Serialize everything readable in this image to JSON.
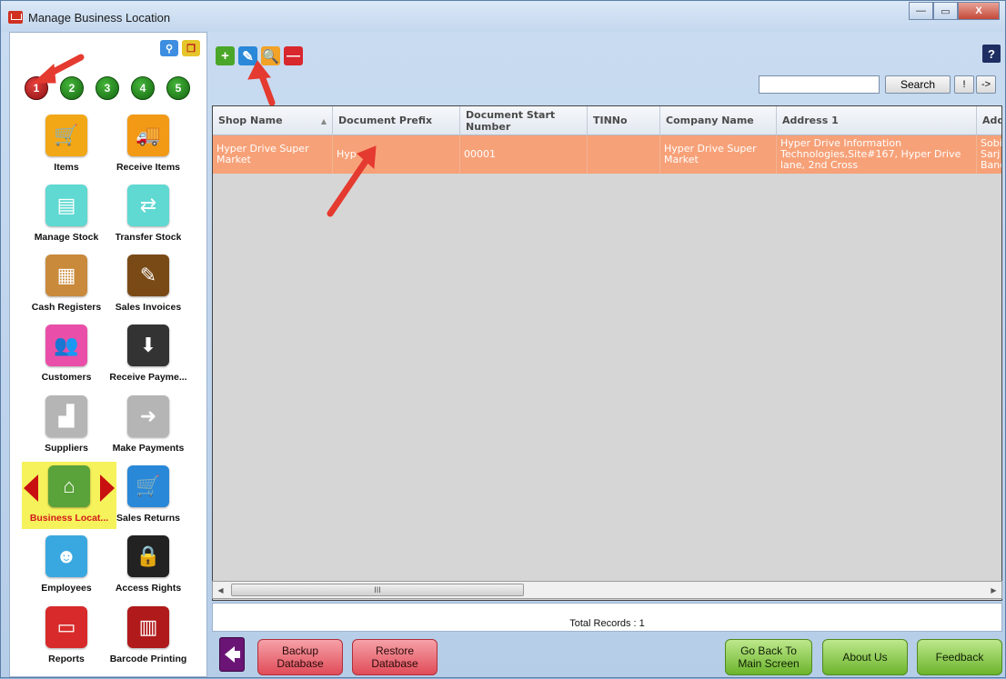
{
  "window": {
    "title": "Manage Business Location",
    "controls": [
      "—",
      "▭",
      "X"
    ]
  },
  "sidebar": {
    "pages": [
      "1",
      "2",
      "3",
      "4",
      "5"
    ],
    "active_page": "1",
    "tiles": [
      {
        "label": "Items",
        "icon": "shopping-cart-icon",
        "color": "#f2a716",
        "glyph": "🛒"
      },
      {
        "label": "Receive Items",
        "icon": "truck-icon",
        "color": "#f29a16",
        "glyph": "🚚"
      },
      {
        "label": "Manage Stock",
        "icon": "stock-trolley-icon",
        "color": "#5fd9d2",
        "glyph": "▤"
      },
      {
        "label": "Transfer Stock",
        "icon": "transfer-boxes-icon",
        "color": "#5fd9d2",
        "glyph": "⇄"
      },
      {
        "label": "Cash Registers",
        "icon": "cash-register-icon",
        "color": "#c98a3b",
        "glyph": "▦"
      },
      {
        "label": "Sales Invoices",
        "icon": "invoice-icon",
        "color": "#7a4a16",
        "glyph": "✎"
      },
      {
        "label": "Customers",
        "icon": "customers-icon",
        "color": "#e94fa8",
        "glyph": "👥"
      },
      {
        "label": "Receive Payme...",
        "icon": "receive-payment-icon",
        "color": "#333333",
        "glyph": "⬇"
      },
      {
        "label": "Suppliers",
        "icon": "factory-icon",
        "color": "#b5b5b5",
        "glyph": "▟"
      },
      {
        "label": "Make Payments",
        "icon": "factory-payment-icon",
        "color": "#b5b5b5",
        "glyph": "➜"
      },
      {
        "label": "Business Locat...",
        "icon": "business-location-icon",
        "color": "#5aa23a",
        "glyph": "⌂"
      },
      {
        "label": "Sales Returns",
        "icon": "sales-returns-icon",
        "color": "#2a88d8",
        "glyph": "🛒"
      },
      {
        "label": "Employees",
        "icon": "employee-icon",
        "color": "#3aa8e0",
        "glyph": "☻"
      },
      {
        "label": "Access Rights",
        "icon": "lock-key-icon",
        "color": "#222222",
        "glyph": "🔒"
      },
      {
        "label": "Reports",
        "icon": "reports-icon",
        "color": "#d82a2a",
        "glyph": "▭"
      },
      {
        "label": "Barcode Printing",
        "icon": "barcode-icon",
        "color": "#b01a1a",
        "glyph": "▥"
      }
    ],
    "selected_tile": "Business Locat..."
  },
  "toolbar": {
    "add": "+",
    "edit": "✎",
    "search": "🔍",
    "delete": "—",
    "help": "?"
  },
  "search": {
    "value": "",
    "button": "Search",
    "btn_bang": "!",
    "btn_next": "->"
  },
  "grid": {
    "columns": [
      "Shop Name",
      "Document Prefix",
      "Document Start Number",
      "TINNo",
      "Company Name",
      "Address 1",
      "Add"
    ],
    "rows": [
      [
        "Hyper Drive Super Market",
        "Hyp",
        "00001",
        "",
        "Hyper Drive Super Market",
        "Hyper Drive Information Technologies,Site#167, Hyper Drive lane, 2nd Cross",
        "Sobi Sarj Banc"
      ]
    ],
    "scroll_thumb": "III"
  },
  "status": {
    "total_records": "Total Records : 1"
  },
  "footer": {
    "backup": "Backup\nDatabase",
    "restore": "Restore\nDatabase",
    "go_back": "Go Back To\nMain Screen",
    "about": "About Us",
    "feedback": "Feedback"
  },
  "colors": {
    "selected_row": "#f7a178",
    "accent_red": "#e04c58",
    "accent_green": "#6cb42c"
  }
}
